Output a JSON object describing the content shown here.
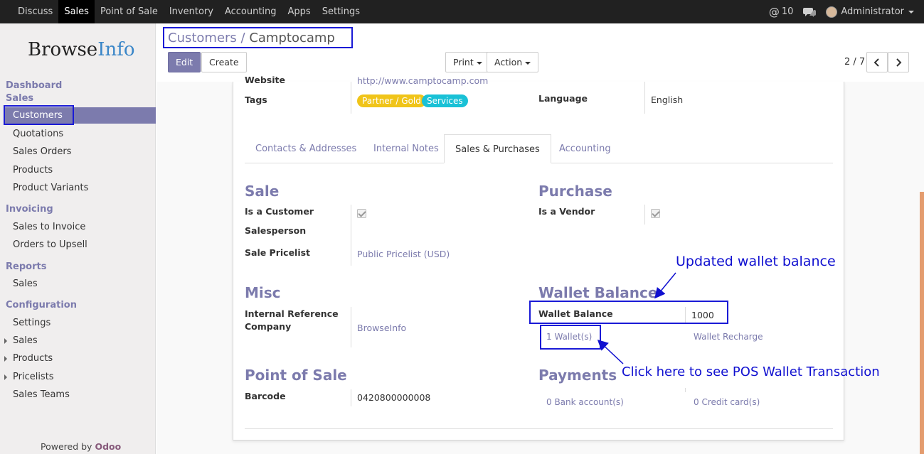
{
  "topbar": {
    "menu": [
      "Discuss",
      "Sales",
      "Point of Sale",
      "Inventory",
      "Accounting",
      "Apps",
      "Settings"
    ],
    "active": "Sales",
    "notifications": "10",
    "user": "Administrator"
  },
  "sidebar": {
    "logo_a": "Browse",
    "logo_b": "Info",
    "dashboard": "Dashboard",
    "sales_head": "Sales",
    "customers": "Customers",
    "quotations": "Quotations",
    "sales_orders": "Sales Orders",
    "products": "Products",
    "product_variants": "Product Variants",
    "invoicing_head": "Invoicing",
    "sales_to_invoice": "Sales to Invoice",
    "orders_to_upsell": "Orders to Upsell",
    "reports_head": "Reports",
    "reports_sales": "Sales",
    "config_head": "Configuration",
    "settings": "Settings",
    "cfg_sales": "Sales",
    "cfg_products": "Products",
    "cfg_pricelists": "Pricelists",
    "sales_teams": "Sales Teams",
    "powered_by": "Powered by",
    "odoo": "Odoo"
  },
  "control": {
    "breadcrumb_parent": "Customers",
    "breadcrumb_sep": " / ",
    "breadcrumb_current": "Camptocamp",
    "edit": "Edit",
    "create": "Create",
    "print": "Print",
    "action": "Action",
    "pager": "2 / 7"
  },
  "form": {
    "website_label": "Website",
    "website": "http://www.camptocamp.com",
    "tags_label": "Tags",
    "tags": [
      "Partner / Gold",
      "Services"
    ],
    "language_label": "Language",
    "language": "English",
    "tabs": [
      "Contacts & Addresses",
      "Internal Notes",
      "Sales & Purchases",
      "Accounting"
    ],
    "active_tab": "Sales & Purchases",
    "sale_title": "Sale",
    "is_customer": "Is a Customer",
    "salesperson": "Salesperson",
    "sale_pricelist": "Sale Pricelist",
    "pricelist_value": "Public Pricelist (USD)",
    "purchase_title": "Purchase",
    "is_vendor": "Is a Vendor",
    "misc_title": "Misc",
    "internal_ref": "Internal Reference",
    "company": "Company",
    "company_value": "BrowseInfo",
    "wallet_title": "Wallet Balance",
    "wallet_label": "Wallet Balance",
    "wallet_value": "1000",
    "wallets_link": "1 Wallet(s)",
    "wallet_recharge": "Wallet Recharge",
    "pos_title": "Point of Sale",
    "barcode_label": "Barcode",
    "barcode_value": "0420800000008",
    "payments_title": "Payments",
    "bank_accounts": "0 Bank account(s)",
    "credit_cards": "0 Credit card(s)"
  },
  "annotations": {
    "updated": "Updated wallet balance",
    "click_here": "Click here to see POS Wallet Transaction"
  },
  "colors": {
    "accent": "#7c7bad",
    "annotation": "#1010d0",
    "tag_gold": "#f0c419",
    "tag_services": "#19c1d6"
  }
}
